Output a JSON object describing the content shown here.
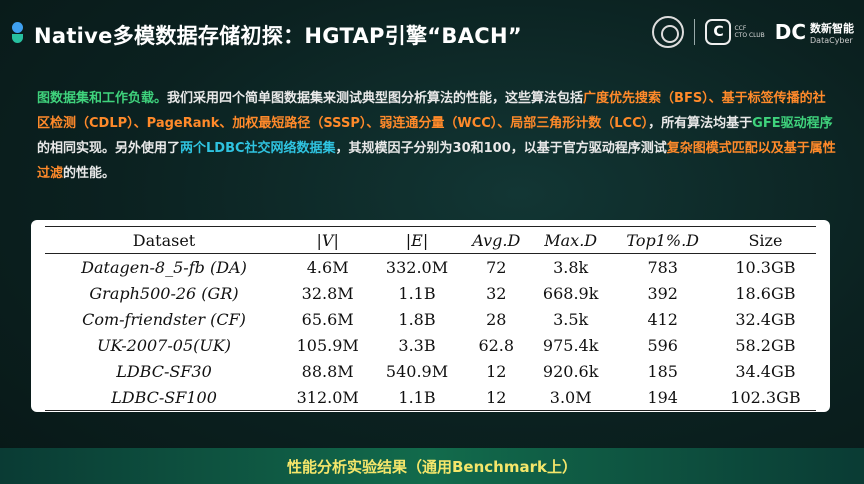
{
  "header": {
    "title": "Native多模数据存储初探：HGTAP引擎“BACH”",
    "logos": {
      "cto_text_1": "CCF",
      "cto_text_2": "CTO CLUB",
      "dc_mark": "DC",
      "dc_name": "数新智能",
      "dc_en": "DataCyber"
    }
  },
  "paragraph": {
    "p1": "图数据集和工作负载。",
    "p2": "我们采用四个简单图数据集来测试典型图分析算法的性能，这些算法包括",
    "p3": "广度优先搜索（BFS）、基于标签传播的社区检测（CDLP）、PageRank、加权最短路径（SSSP）、弱连通分量（WCC）、局部三角形计数（LCC）",
    "p4": "，所有算法均基于",
    "p5": "GFE驱动程序",
    "p6": "的相同实现。另外使用了",
    "p7": "两个LDBC社交网络数据集",
    "p8": "，其规模因子分别为30和100，以基于官方驱动程序测试",
    "p9": "复杂图模式匹配以及基于属性过滤",
    "p10": "的性能。"
  },
  "table": {
    "headers": [
      "Dataset",
      "|V|",
      "|E|",
      "Avg.D",
      "Max.D",
      "Top1%.D",
      "Size"
    ],
    "rows": [
      [
        "Datagen-8_5-fb (DA)",
        "4.6M",
        "332.0M",
        "72",
        "3.8k",
        "783",
        "10.3GB"
      ],
      [
        "Graph500-26 (GR)",
        "32.8M",
        "1.1B",
        "32",
        "668.9k",
        "392",
        "18.6GB"
      ],
      [
        "Com-friendster (CF)",
        "65.6M",
        "1.8B",
        "28",
        "3.5k",
        "412",
        "32.4GB"
      ],
      [
        "UK-2007-05(UK)",
        "105.9M",
        "3.3B",
        "62.8",
        "975.4k",
        "596",
        "58.2GB"
      ],
      [
        "LDBC-SF30",
        "88.8M",
        "540.9M",
        "12",
        "920.6k",
        "185",
        "34.4GB"
      ],
      [
        "LDBC-SF100",
        "312.0M",
        "1.1B",
        "12",
        "3.0M",
        "194",
        "102.3GB"
      ]
    ]
  },
  "footer": {
    "text": "性能分析实验结果（通用Benchmark上）"
  },
  "colors": {
    "green": "#3fd27c",
    "orange": "#ff8a2a",
    "cyan": "#2fc3e0",
    "footer_text": "#f5e66a"
  }
}
